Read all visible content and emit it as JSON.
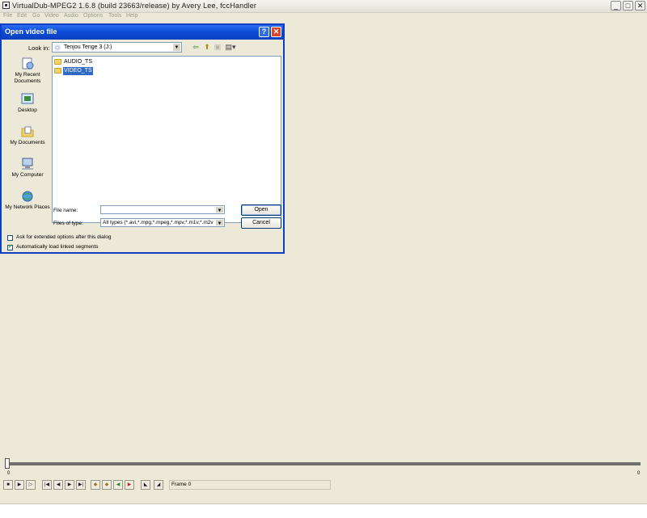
{
  "app": {
    "title": "VirtualDub-MPEG2 1.6.8 (build 23663/release) by Avery Lee, fccHandler",
    "menu": [
      "File",
      "Edit",
      "Go",
      "Video",
      "Audio",
      "Options",
      "Tools",
      "Help"
    ]
  },
  "dialog": {
    "title": "Open video file",
    "help_glyph": "?",
    "close_glyph": "✕",
    "look_in_label": "Look in:",
    "look_in_value": "Tenjou Tenge 3 (J:)",
    "places": [
      {
        "label": "My Recent Documents",
        "icon": "recent-documents-icon"
      },
      {
        "label": "Desktop",
        "icon": "desktop-icon"
      },
      {
        "label": "My Documents",
        "icon": "my-documents-icon"
      },
      {
        "label": "My Computer",
        "icon": "my-computer-icon"
      },
      {
        "label": "My Network Places",
        "icon": "network-places-icon"
      }
    ],
    "files": [
      {
        "name": "AUDIO_TS",
        "selected": false
      },
      {
        "name": "VIDEO_TS",
        "selected": true
      }
    ],
    "file_name_label": "File name:",
    "file_name_value": "",
    "files_of_type_label": "Files of type:",
    "files_of_type_value": "All types (*.avi,*.mpg,*.mpeg,*.mpv,*.m1v,*.m2v",
    "open_label": "Open",
    "cancel_label": "Cancel",
    "extended_options_label": "Ask for extended options after this dialog",
    "extended_options_checked": false,
    "auto_load_label": "Automatically load linked segments",
    "auto_load_checked": true
  },
  "timeline": {
    "start_tick": "0",
    "end_tick": "0",
    "frame_text": "Frame 0"
  }
}
